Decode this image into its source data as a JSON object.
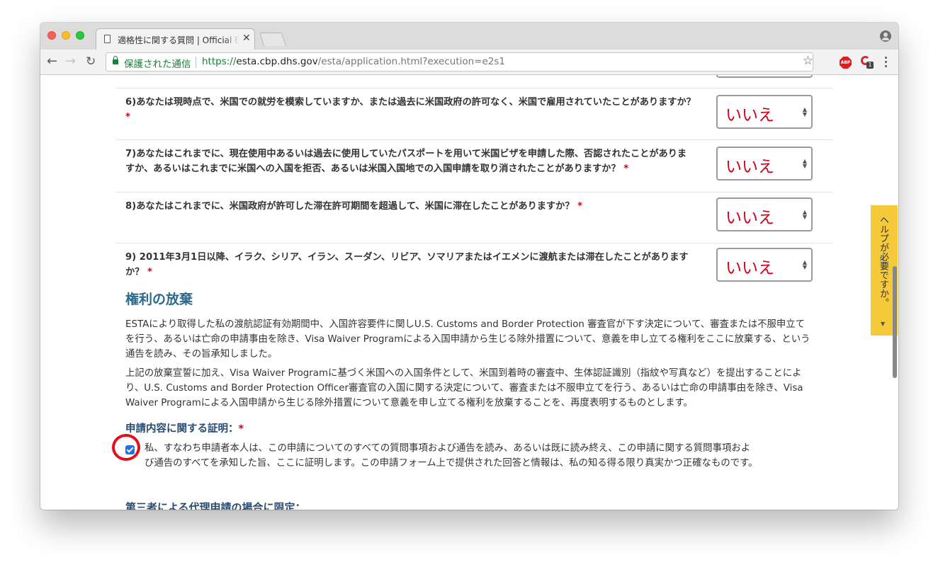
{
  "browser": {
    "tab_title": "適格性に関する質問 | Official ESTA Application Website",
    "tab_close": "✕",
    "secure_label": "保護された通信",
    "url_scheme": "https://",
    "url_host": "esta.cbp.dhs.gov",
    "url_path": "/esta/application.html?execution=e2s1",
    "star": "☆",
    "abp_label": "ABP",
    "ext_badge": "1",
    "nav": {
      "back": "←",
      "forward": "→",
      "reload": "↻"
    }
  },
  "questions": [
    {
      "text": "6)あなたは現時点で、米国での就労を模索していますか、または過去に米国政府の許可なく、米国で雇用されていたことがありますか？",
      "answer": "いいえ"
    },
    {
      "text": "7)あなたはこれまでに、現在使用中あるいは過去に使用していたパスポートを用いて米国ビザを申請した際、否認されたことがありますか、あるいはこれまでに米国への入国を拒否、あるいは米国入国地での入国申請を取り消されたことがありますか？",
      "answer": "いいえ"
    },
    {
      "text": "8)あなたはこれまでに、米国政府が許可した滞在許可期間を超過して、米国に滞在したことがありますか？",
      "answer": "いいえ"
    },
    {
      "text": "9) 2011年3月1日以降、イラク、シリア、イラン、スーダン、リビア、ソマリアまたはイエメンに渡航または滞在したことがありますか？",
      "answer": "いいえ"
    }
  ],
  "required_marker": "*",
  "waiver": {
    "title": "権利の放棄",
    "para1": "ESTAにより取得した私の渡航認証有効期間中、入国許容要件に関しU.S. Customs and Border Protection 審査官が下す決定について、審査または不服申立てを行う、あるいは亡命の申請事由を除き、Visa Waiver Programによる入国申請から生じる除外措置について、意義を申し立てる権利をここに放棄する、という通告を読み、その旨承知しました。",
    "para2": "上記の放棄宣誓に加え、Visa Waiver Programに基づく米国への入国条件として、米国到着時の審査中、生体認証識別（指紋や写真など）を提出することにより、U.S. Customs and Border Protection Officer審査官の入国に関する決定について、審査または不服申立てを行う、あるいは亡命の申請事由を除き、Visa Waiver Programによる入国申請から生じる除外措置について意義を申し立てる権利を放棄することを、再度表明するものとします。"
  },
  "certification": {
    "label": "申請内容に関する証明：",
    "checked": true,
    "text": "私、すなわち申請者本人は、この申請についてのすべての質問事項および通告を読み、あるいは既に読み終え、この申請に関する質問事項および通告のすべてを承知した旨、ここに証明します。この申請フォーム上で提供された回答と情報は、私の知る得る限り真実かつ正確なものです。"
  },
  "next_heading": "第三者による代理申請の場合に限定：",
  "help_tab": {
    "label": "ヘルプが必要ですか。",
    "arrow": "▼"
  },
  "colors": {
    "accent_red": "#d0021b",
    "heading_blue": "#2a6a8c",
    "help_yellow": "#f4c93a"
  }
}
